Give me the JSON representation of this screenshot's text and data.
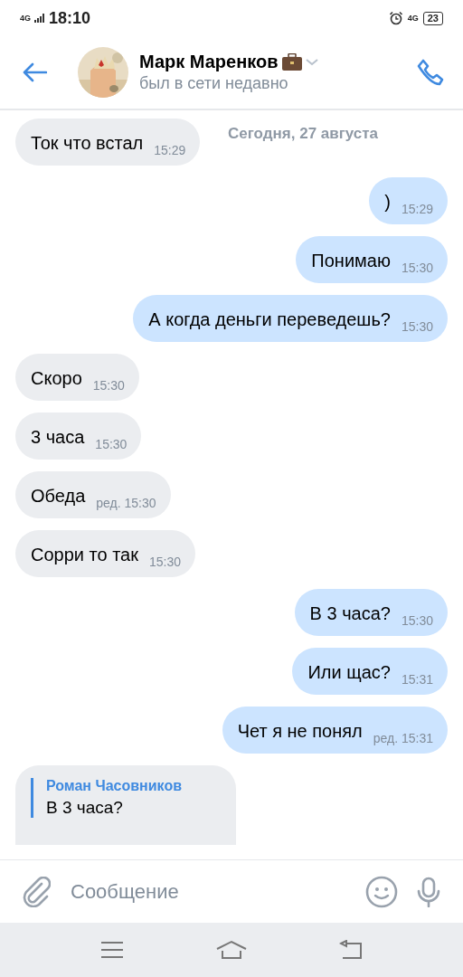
{
  "status_bar": {
    "network": "4G",
    "time": "18:10",
    "network_right": "4G",
    "battery": "23"
  },
  "header": {
    "name": "Марк Маренков",
    "status": "был в сети недавно"
  },
  "date_label": "Сегодня, 27 августа",
  "messages": [
    {
      "kind": "in",
      "text": "Ток что встал",
      "time": "15:29"
    },
    {
      "kind": "out",
      "text": ")",
      "time": "15:29"
    },
    {
      "kind": "out",
      "text": "Понимаю",
      "time": "15:30"
    },
    {
      "kind": "out",
      "text": "А когда деньги переведешь?",
      "time": "15:30"
    },
    {
      "kind": "in",
      "text": "Скоро",
      "time": "15:30"
    },
    {
      "kind": "in",
      "text": "3 часа",
      "time": "15:30"
    },
    {
      "kind": "in",
      "text": "Обеда",
      "time": "ред. 15:30"
    },
    {
      "kind": "in",
      "text": "Сорри то так",
      "time": "15:30"
    },
    {
      "kind": "out",
      "text": "В 3 часа?",
      "time": "15:30"
    },
    {
      "kind": "out",
      "text": "Или щас?",
      "time": "15:31"
    },
    {
      "kind": "out",
      "text": "Чет я не понял",
      "time": "ред. 15:31"
    },
    {
      "kind": "reply",
      "author": "Роман Часовников",
      "text": "В 3 часа?"
    }
  ],
  "composer": {
    "placeholder": "Сообщение"
  }
}
